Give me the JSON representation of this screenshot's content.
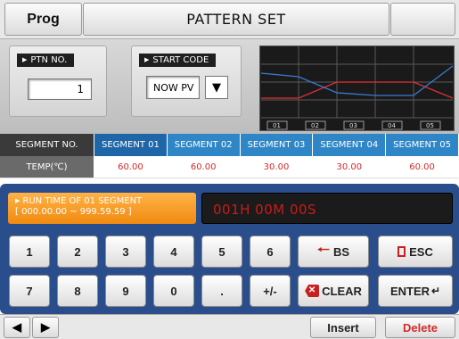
{
  "header": {
    "prog_label": "Prog",
    "title": "PATTERN SET"
  },
  "pattern": {
    "ptn_label": "PTN NO.",
    "ptn_value": "1",
    "start_label": "START CODE",
    "start_value": "NOW PV"
  },
  "graph": {
    "ticks": [
      "01",
      "02",
      "03",
      "04",
      "05"
    ]
  },
  "segments": {
    "header_label": "SEGMENT NO.",
    "names": [
      "SEGMENT 01",
      "SEGMENT 02",
      "SEGMENT 03",
      "SEGMENT 04",
      "SEGMENT 05"
    ],
    "temp_label": "TEMP(℃)",
    "temps": [
      "60.00",
      "60.00",
      "30.00",
      "30.00",
      "60.00"
    ]
  },
  "input": {
    "title": "RUN TIME OF 01 SEGMENT",
    "range": "[ 000.00.00 ~ 999.59.59 ]",
    "value": "001H 00M 00S"
  },
  "keypad": {
    "row1": [
      "1",
      "2",
      "3",
      "4",
      "5",
      "6"
    ],
    "row2": [
      "7",
      "8",
      "9",
      "0",
      ".",
      "+/-"
    ],
    "bs": "BS",
    "esc": "ESC",
    "clear": "CLEAR",
    "enter": "ENTER"
  },
  "footer": {
    "insert": "Insert",
    "delete": "Delete"
  },
  "colors": {
    "accent": "#2f86c6",
    "delete": "#d32b2b",
    "panel": "#2a4d8c",
    "runtime": "#f08a10",
    "red_line": "#e03030",
    "blue_line": "#3a7bd5"
  }
}
